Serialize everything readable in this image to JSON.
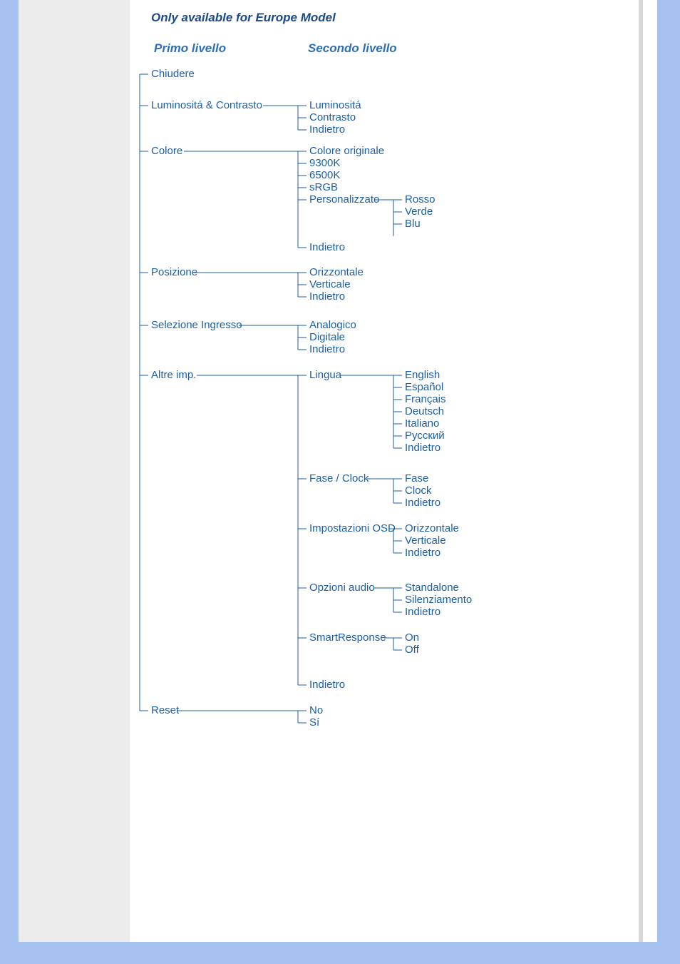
{
  "note": "Only available for Europe Model",
  "headers": {
    "first": "Primo livello",
    "second": "Secondo livello"
  },
  "tree": {
    "chiudere": "Chiudere",
    "lum_contr": {
      "label": "Luminositá & Contrasto",
      "children": {
        "lum": "Luminositá",
        "contr": "Contrasto",
        "back": "Indietro"
      }
    },
    "colore": {
      "label": "Colore",
      "children": {
        "orig": "Colore originale",
        "k9300": "9300K",
        "k6500": "6500K",
        "srgb": "sRGB",
        "pers": {
          "label": "Personalizzato",
          "children": {
            "r": "Rosso",
            "g": "Verde",
            "b": "Blu"
          }
        },
        "back": "Indietro"
      }
    },
    "pos": {
      "label": "Posizione",
      "children": {
        "h": "Orizzontale",
        "v": "Verticale",
        "back": "Indietro"
      }
    },
    "sel": {
      "label": "Selezione Ingresso",
      "children": {
        "ana": "Analogico",
        "dig": "Digitale",
        "back": "Indietro"
      }
    },
    "altre": {
      "label": "Altre imp.",
      "children": {
        "lingua": {
          "label": "Lingua",
          "children": {
            "en": "English",
            "es": "Español",
            "fr": "Français",
            "de": "Deutsch",
            "it": "Italiano",
            "ru": "Русский",
            "back": "Indietro"
          }
        },
        "fase": {
          "label": "Fase / Clock",
          "children": {
            "f": "Fase",
            "c": "Clock",
            "back": "Indietro"
          }
        },
        "osd": {
          "label": "Impostazioni OSD",
          "children": {
            "h": "Orizzontale",
            "v": "Verticale",
            "back": "Indietro"
          }
        },
        "audio": {
          "label": "Opzioni audio",
          "children": {
            "sa": "Standalone",
            "sil": "Silenziamento",
            "back": "Indietro"
          }
        },
        "sr": {
          "label": "SmartResponse",
          "children": {
            "on": "On",
            "off": "Off"
          }
        },
        "back": "Indietro"
      }
    },
    "reset": {
      "label": "Reset",
      "children": {
        "no": "No",
        "si": "Sí"
      }
    }
  }
}
